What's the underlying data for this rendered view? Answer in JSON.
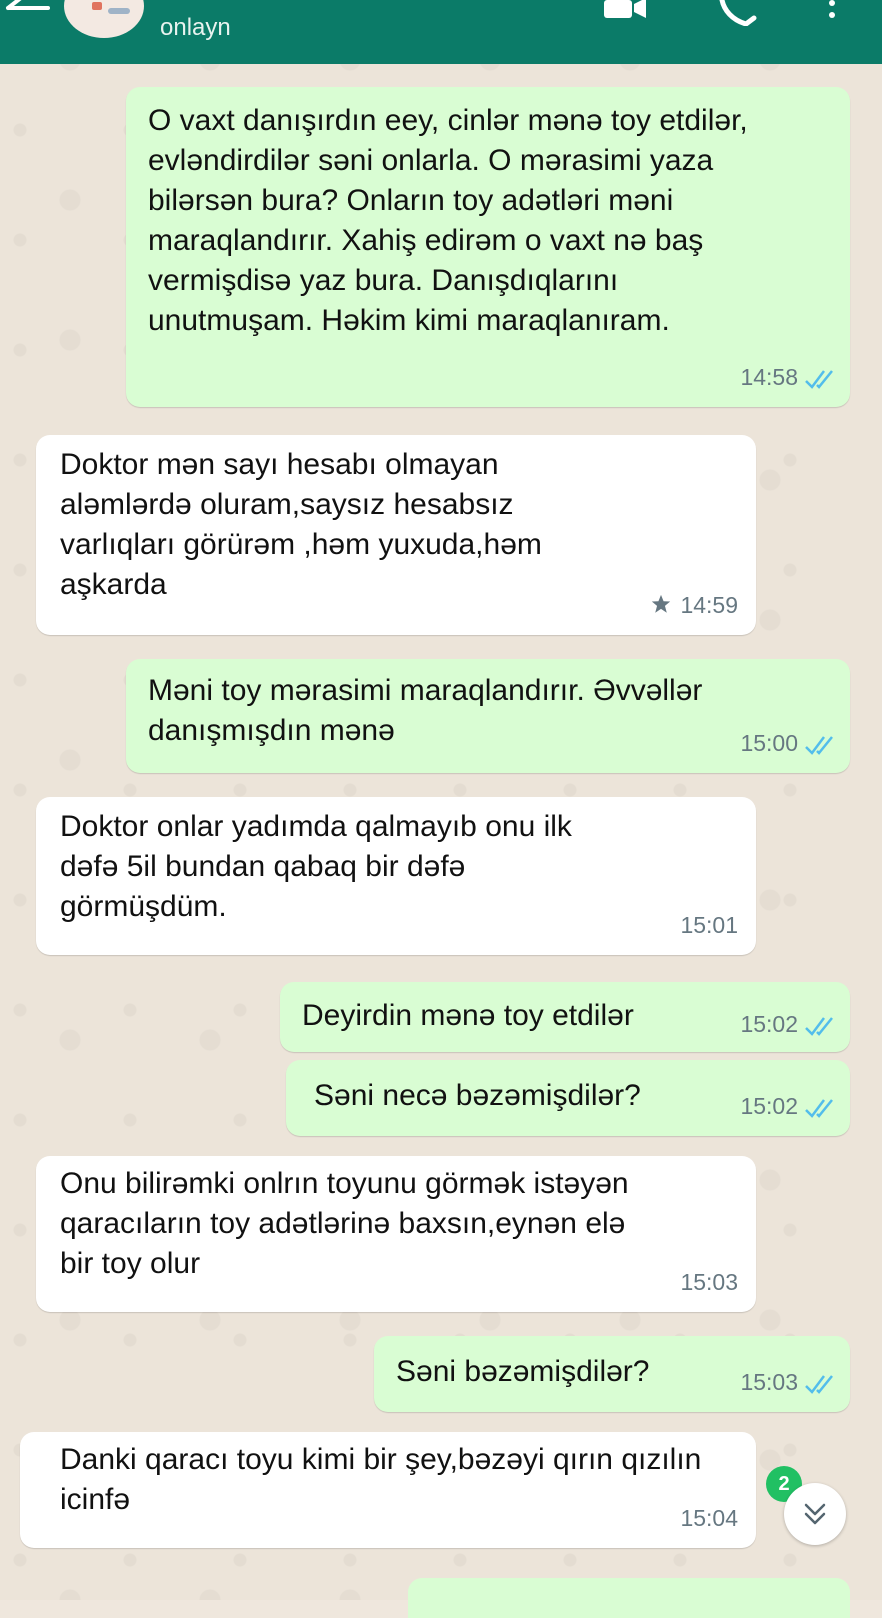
{
  "header": {
    "status": "onlayn"
  },
  "colors": {
    "header": "#0b7b68",
    "outgoing_bubble": "#d9fdd3",
    "incoming_bubble": "#ffffff",
    "read_ticks": "#53bdeb",
    "unread_badge": "#21c063"
  },
  "messages": [
    {
      "direction": "out",
      "text": "O vaxt danışırdın eey, cinlər mənə toy etdilər,  evləndirdilər səni onlarla. O mərasimi yaza bilərsən bura? Onların toy adətləri məni maraqlandırır. Xahiş edirəm o  vaxt nə baş vermişdisə yaz bura. Danışdıqlarını unutmuşam. Həkim kimi maraqlanıram.",
      "time": "14:58",
      "status": "read"
    },
    {
      "direction": "in",
      "text": "Doktor mən sayı hesabı olmayan aləmlərdə oluram,saysız hesabsız varlıqları görürəm ,həm yuxuda,həm aşkarda",
      "time": "14:59",
      "starred": true
    },
    {
      "direction": "out",
      "text": "Məni toy mərasimi maraqlandırır. Əvvəllər danışmışdın mənə",
      "time": "15:00",
      "status": "read"
    },
    {
      "direction": "in",
      "text": "Doktor onlar yadımda qalmayıb onu ilk dəfə 5il bundan qabaq bir dəfə görmüşdüm.",
      "time": "15:01"
    },
    {
      "direction": "out",
      "text": "Deyirdin mənə toy etdilər",
      "time": "15:02",
      "status": "read"
    },
    {
      "direction": "out",
      "text": "Səni necə bəzəmişdilər?",
      "time": "15:02",
      "status": "read"
    },
    {
      "direction": "in",
      "text": "Onu bilirəmki onlrın toyunu görmək istəyən qaracıların toy adətlərinə baxsın,eynən elə bir toy olur",
      "time": "15:03"
    },
    {
      "direction": "out",
      "text": "Səni bəzəmişdilər?",
      "time": "15:03",
      "status": "read"
    },
    {
      "direction": "in",
      "text": "Danki qaracı toyu kimi bir şey,bəzəyi qırın qızılın icinfə",
      "time": "15:04"
    }
  ],
  "unread_count": "2",
  "icons": {
    "back": "back-arrow-icon",
    "video": "video-call-icon",
    "call": "phone-icon",
    "menu": "more-vert-icon",
    "scroll": "chevron-double-down-icon"
  }
}
